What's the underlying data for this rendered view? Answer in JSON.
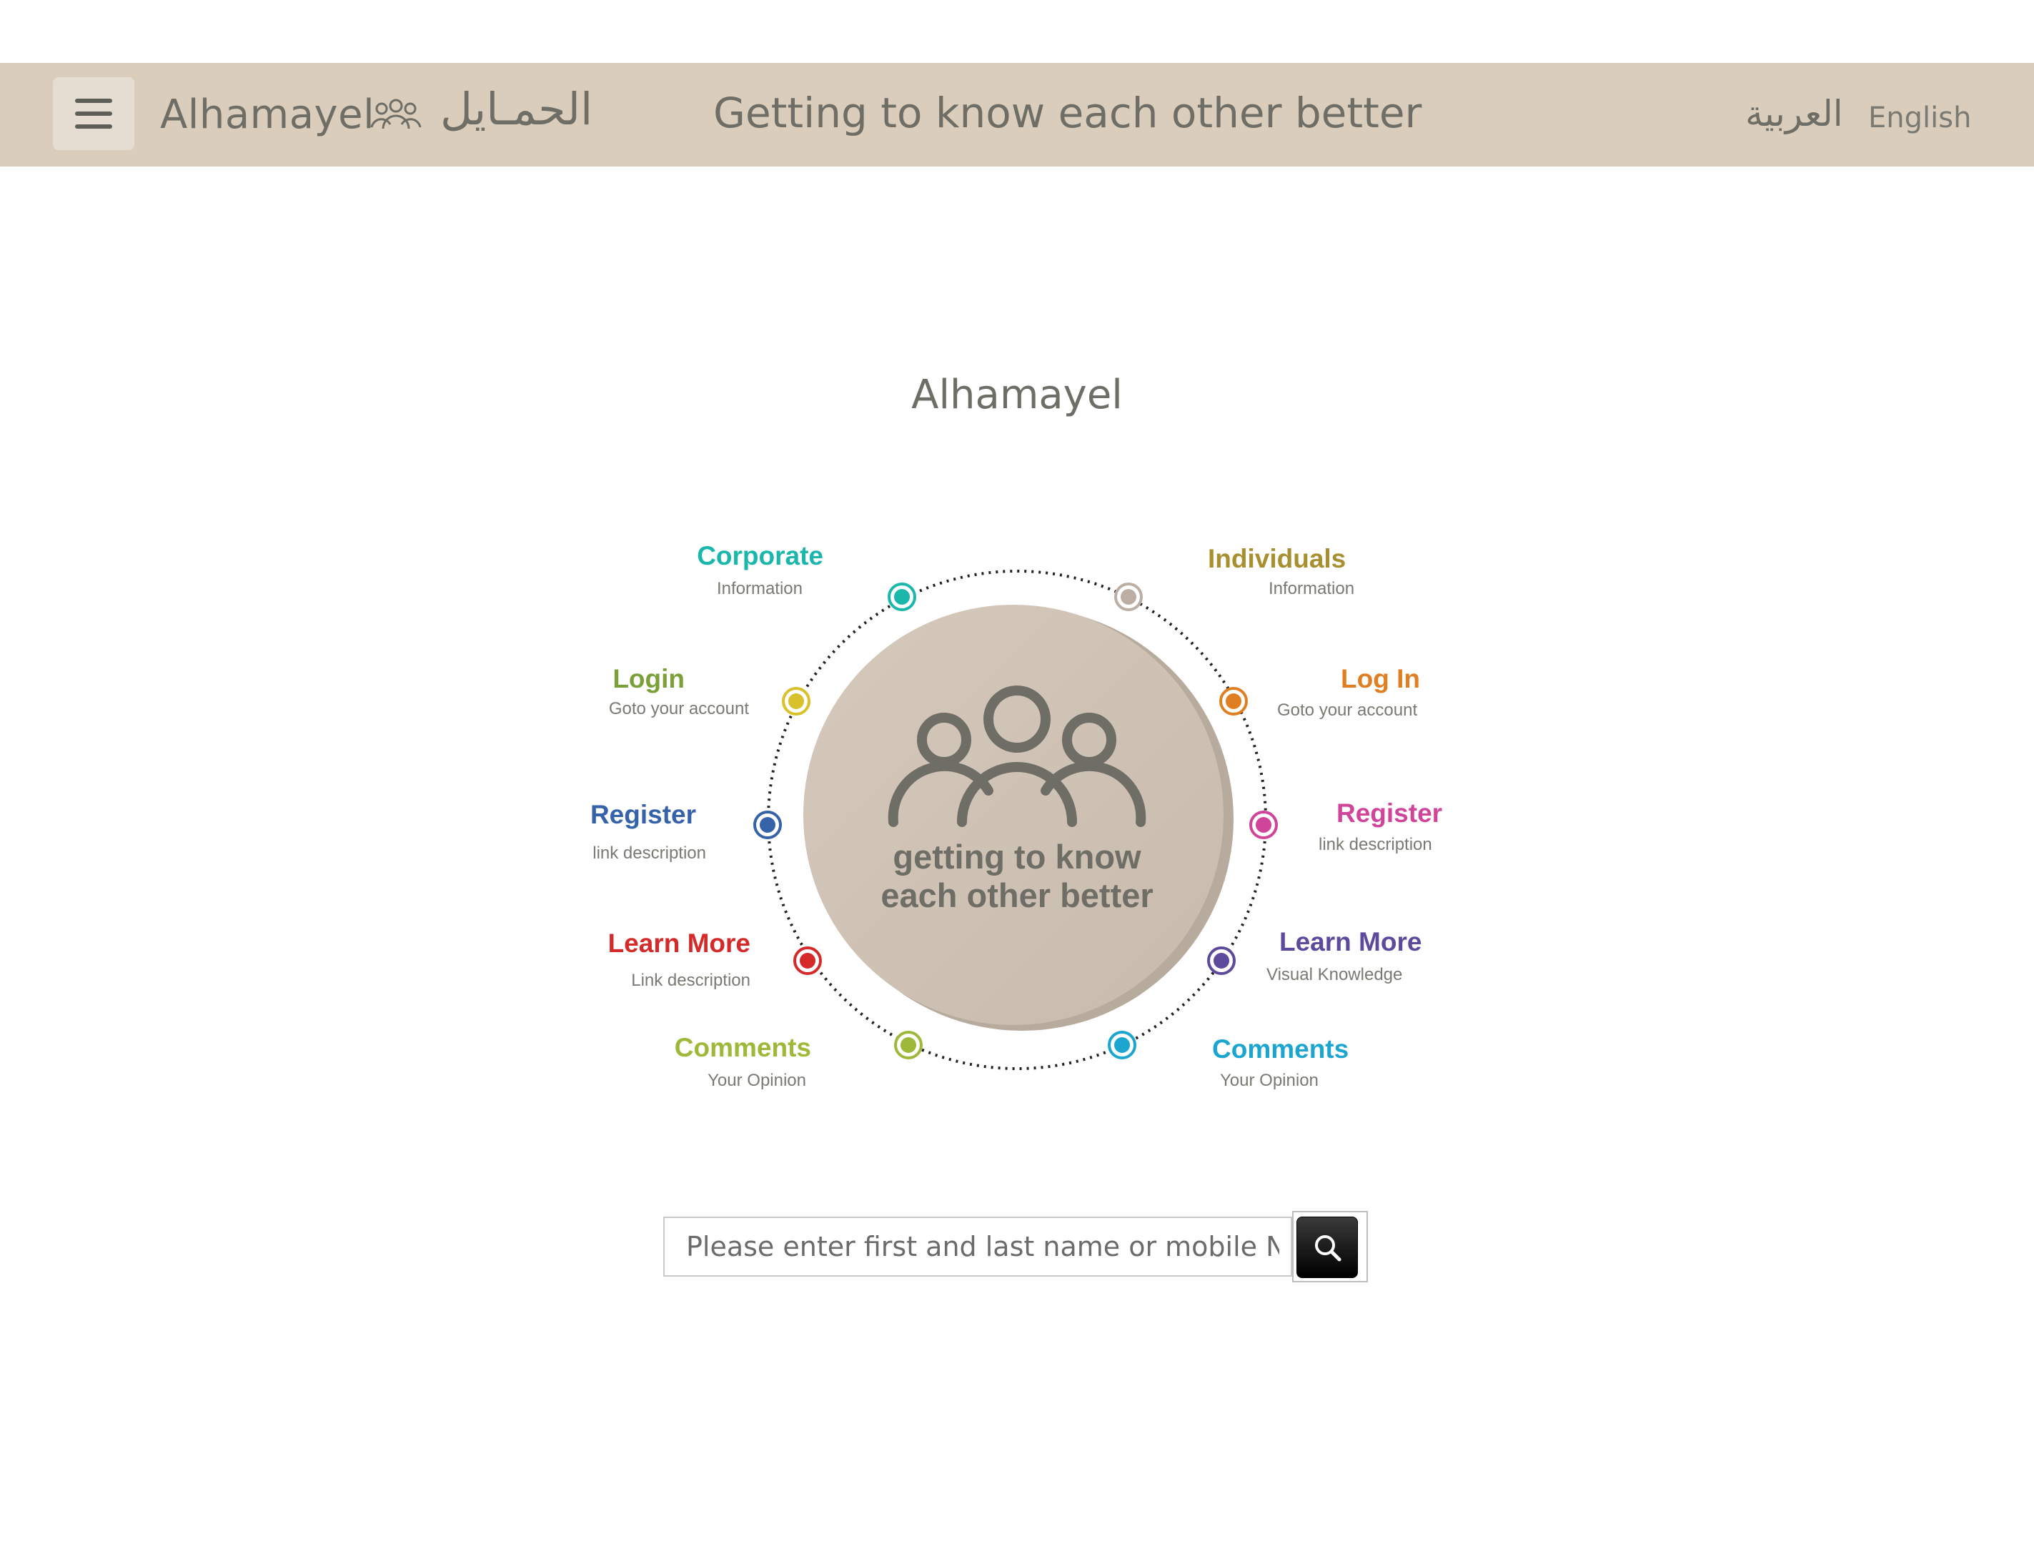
{
  "header": {
    "brand_en": "Alhamayel",
    "brand_ar": "الحمـايل",
    "tagline": "Getting to know each other better",
    "lang_ar": "العربية",
    "lang_en": "English",
    "icons": [
      "menu-icon",
      "people-icon"
    ],
    "background_color": "#dacdbc"
  },
  "main": {
    "title": "Alhamayel",
    "center_text_line1": "getting to know",
    "center_text_line2": "each other better",
    "center_icon": "people-icon"
  },
  "radial_items": [
    {
      "title": "Corporate",
      "desc": "Information",
      "color": "#1bb7ab",
      "side": "left"
    },
    {
      "title": "Individuals",
      "desc": "Information",
      "color": "#a89030",
      "side": "right"
    },
    {
      "title": "Login",
      "desc": "Goto your account",
      "color": "#7ba03a",
      "side": "left"
    },
    {
      "title": "Log In",
      "desc": "Goto your account",
      "color": "#e07f22",
      "side": "right"
    },
    {
      "title": "Register",
      "desc": "link description",
      "color": "#3562a8",
      "side": "left"
    },
    {
      "title": "Register",
      "desc": "link description",
      "color": "#d0449a",
      "side": "right"
    },
    {
      "title": "Learn More",
      "desc": "Link description",
      "color": "#d42a2a",
      "side": "left"
    },
    {
      "title": "Learn More",
      "desc": "Visual Knowledge",
      "color": "#5d4a9c",
      "side": "right"
    },
    {
      "title": "Comments",
      "desc": "Your Opinion",
      "color": "#9eb83a",
      "side": "left"
    },
    {
      "title": "Comments",
      "desc": "Your Opinion",
      "color": "#1ca6cf",
      "side": "right"
    }
  ],
  "dot_colors": {
    "corporate": "#1bb7ab",
    "individuals": "#bcaea3",
    "login_left": "#d8c12a",
    "login_right": "#e07f22",
    "register_left": "#3562a8",
    "register_right": "#d0449a",
    "learn_left": "#d42a2a",
    "learn_right": "#5d4a9c",
    "comments_left": "#9eb83a",
    "comments_right": "#1ca6cf"
  },
  "search": {
    "placeholder": "Please enter first and last name or mobile No",
    "value": "",
    "button_icon": "search-icon"
  }
}
